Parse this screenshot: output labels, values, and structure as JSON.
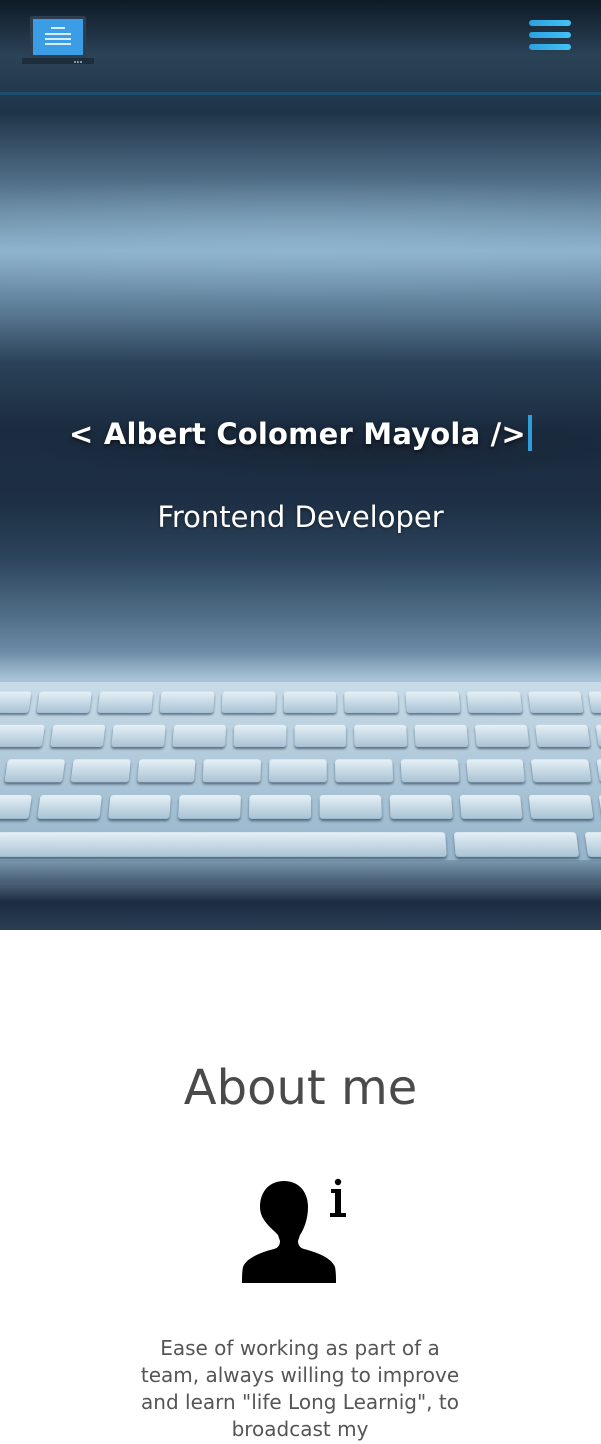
{
  "header": {
    "logo_icon": "laptop-icon",
    "menu_icon": "hamburger-menu-icon"
  },
  "hero": {
    "title": "< Albert Colomer Mayola />",
    "subtitle": "Frontend Developer"
  },
  "about": {
    "heading": "About me",
    "icon": "user-info-icon",
    "text": "Ease of working as part of a team, always willing to improve and learn \"life Long Learnig\", to broadcast my"
  },
  "colors": {
    "accent": "#2f9fdc",
    "menu": "#2aa2e0",
    "heading": "#4a4a4a",
    "body_text": "#555555"
  }
}
